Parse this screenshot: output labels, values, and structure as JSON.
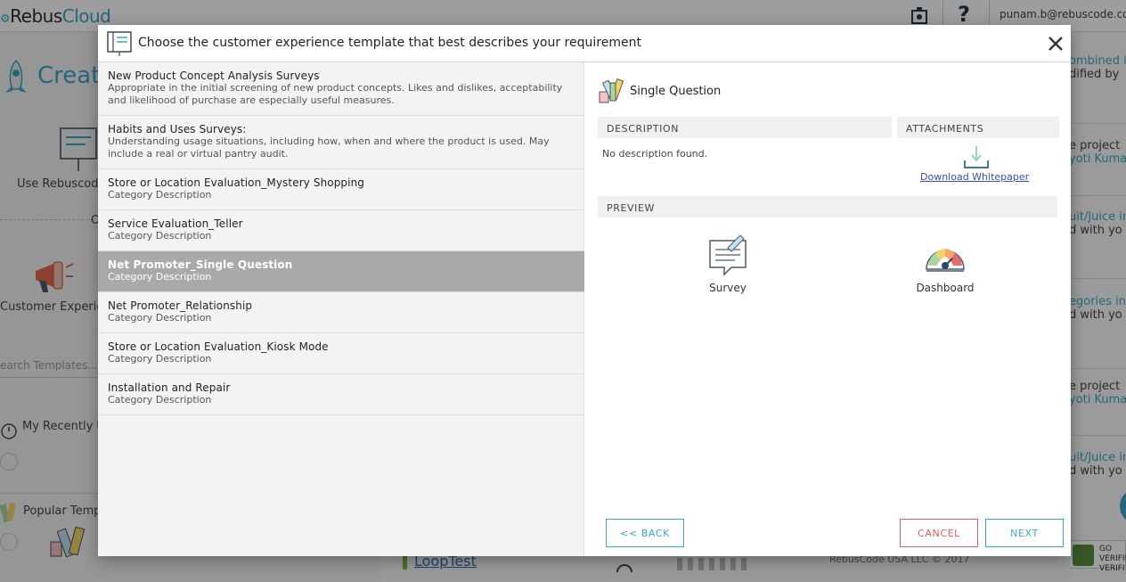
{
  "app": {
    "logo_prefix": "Rebus",
    "logo_suffix": "Cloud",
    "user_email": "punam.b@rebuscode.com",
    "help_label": "?"
  },
  "background_left": {
    "create_heading": "Create",
    "use_rebuscode_label": "Use Rebuscode",
    "or_label": "O",
    "customer_experience_label": "Customer Experien",
    "search_placeholder": "earch Templates...",
    "recently_used_label": "My Recently U",
    "popular_templates_label": "Popular Temp"
  },
  "background_right": {
    "items": [
      {
        "line1": "ombined in",
        "line2": "dified by"
      },
      {
        "line1": "e project",
        "line2": "yoti Kuma"
      },
      {
        "line1": "uit/Juice in",
        "line2": "d with yo"
      },
      {
        "line1": "egories in",
        "line2": "d with yo"
      },
      {
        "line1": "e project",
        "line2": "yoti Kuma"
      },
      {
        "line1": "uit/Juice in",
        "line2": "d with yo"
      }
    ],
    "badge_line1": "GO",
    "badge_line2": "VERIFIE",
    "badge_line3": "VERIFI"
  },
  "background_bottom": {
    "project_link": "LoopTest",
    "copyright": "RebusCode USA LLC © 2017"
  },
  "modal": {
    "title": "Choose the customer experience template that best describes your requirement",
    "close_label": "×",
    "templates": [
      {
        "title": "New Product Concept Analysis Surveys",
        "description": "Appropriate in the initial screening of new product concepts. Likes and dislikes, acceptability and likelihood of purchase are especially useful measures.",
        "selected": false
      },
      {
        "title": "Habits and Uses Surveys:",
        "description": "Understanding usage situations, including how, when and where the product is used. May include a real or virtual pantry audit.",
        "selected": false
      },
      {
        "title": "Store or Location Evaluation_Mystery Shopping",
        "description": "Category Description",
        "selected": false
      },
      {
        "title": "Service Evaluation_Teller",
        "description": "Category Description",
        "selected": false
      },
      {
        "title": "Net Promoter_Single Question",
        "description": "Category Description",
        "selected": true
      },
      {
        "title": "Net Promoter_Relationship",
        "description": "Category Description",
        "selected": false
      },
      {
        "title": "Store or Location Evaluation_Kiosk Mode",
        "description": "Category Description",
        "selected": false
      },
      {
        "title": "Installation and Repair",
        "description": "Category Description",
        "selected": false
      }
    ],
    "detail": {
      "name": "Single Question",
      "description_heading": "DESCRIPTION",
      "attachments_heading": "ATTACHMENTS",
      "description_text": "No description found.",
      "download_label": "Download Whitepaper",
      "preview_heading": "PREVIEW",
      "preview_items": [
        {
          "label": "Survey",
          "icon": "survey-icon"
        },
        {
          "label": "Dashboard",
          "icon": "dashboard-icon"
        }
      ]
    },
    "buttons": {
      "back": "<< BACK",
      "cancel": "CANCEL",
      "next": "NEXT"
    }
  },
  "colors": {
    "accent": "#3aa7c9",
    "cancel": "#e06060",
    "selected_row": "#a9a9a9",
    "link": "#3b4fa8"
  }
}
